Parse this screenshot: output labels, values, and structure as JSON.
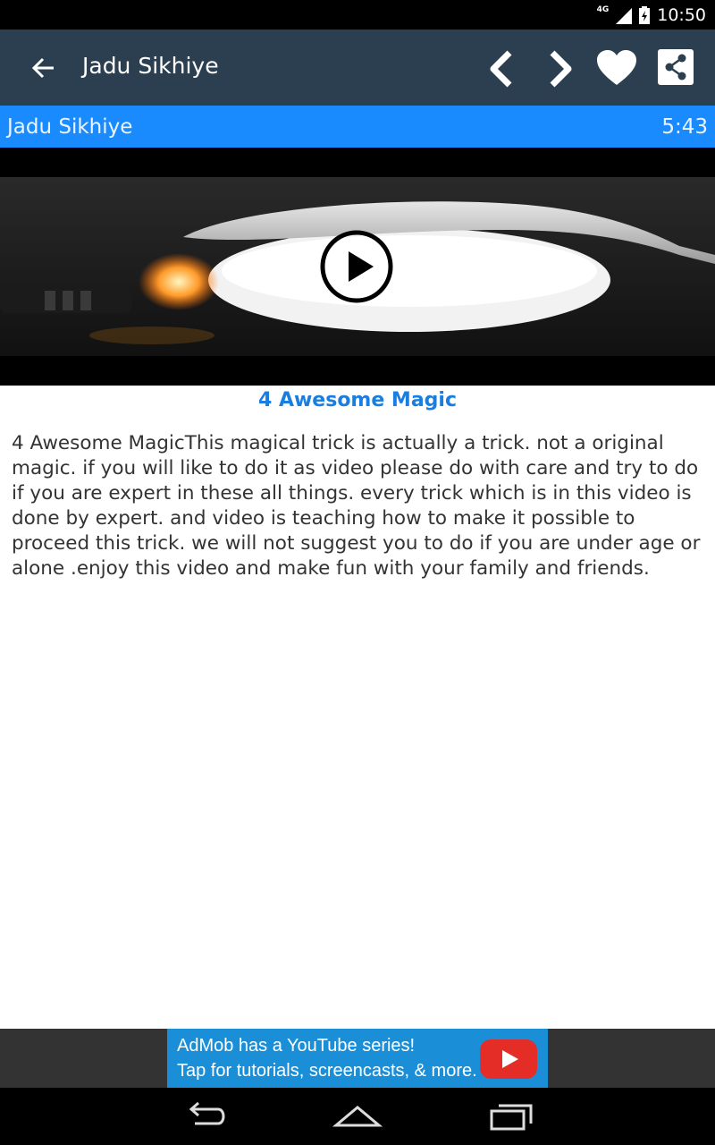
{
  "status_bar": {
    "network": "4G",
    "time": "10:50"
  },
  "app_bar": {
    "title": "Jadu Sikhiye",
    "icons": [
      "arrow-left-icon",
      "chevron-left-icon",
      "chevron-right-icon",
      "heart-icon",
      "share-icon"
    ]
  },
  "info_bar": {
    "name": "Jadu Sikhiye",
    "duration": "5:43"
  },
  "video": {
    "play_icon": "play-icon"
  },
  "content": {
    "title": "4 Awesome Magic",
    "description": "4 Awesome MagicThis magical trick is actually a trick. not a original magic. if you will like to do it as video please do with care and try to do if you are expert in these all things. every trick which is in  this video is done by expert. and video is teaching how to make it possible to proceed this trick. we will not suggest you to do if you are under age or alone .enjoy this video and make fun with your family and friends."
  },
  "ad": {
    "line1": "AdMob has a YouTube series!",
    "line2": "Tap for tutorials, screencasts, & more."
  },
  "colors": {
    "app_bar": "#2b3f50",
    "info_bar": "#1a8bff",
    "title_text": "#1a7ee0",
    "ad_banner": "#1a8fd8"
  }
}
